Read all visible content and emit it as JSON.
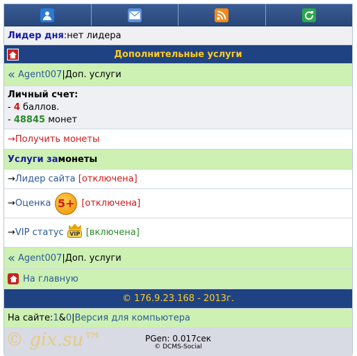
{
  "topbar": {
    "icons": [
      "user-icon",
      "mail-icon",
      "rss-icon",
      "refresh-icon"
    ]
  },
  "leader": {
    "label": "Лидер дня",
    "sep": " : ",
    "value": "нет лидера"
  },
  "header": {
    "title": "Дополнительные услуги"
  },
  "breadcrumb": {
    "arrow": "«",
    "user": "Agent007",
    "sep": " | ",
    "page": "Доп. услуги"
  },
  "account": {
    "title": "Личный счет:",
    "points_prefix": "- ",
    "points": "4",
    "points_unit": " баллов.",
    "coins_prefix": "- ",
    "coins": "48845",
    "coins_unit": " монет"
  },
  "get_coins": {
    "arrow": "→ ",
    "label": "Получить монеты"
  },
  "services": {
    "title_a": "Услуги за",
    "title_b": " монеты"
  },
  "service_items": [
    {
      "arrow": "→ ",
      "label": "Лидер сайта",
      "status": "[отключена]"
    },
    {
      "arrow": "→ ",
      "label": "Оценка",
      "badge": "5+",
      "status": "[отключена]"
    },
    {
      "arrow": "→ ",
      "label": "VIP статус",
      "badge": "VIP",
      "status": "[включена]"
    }
  ],
  "home": {
    "label": "На главную"
  },
  "copyright": "© 176.9.23.168 - 2013г.",
  "online": {
    "prefix": "На сайте: ",
    "a": "1",
    "amp": " & ",
    "b": "0",
    "sep": " | ",
    "desktop": "Версия для компьютера"
  },
  "footer": {
    "pgen": "PGen: 0.017сек",
    "engine": "© DCMS-Social",
    "watermark": "© gix.su™"
  },
  "colors": {
    "navy": "#1f4382",
    "green": "#cdf1b3",
    "gold": "#ffcc22"
  }
}
